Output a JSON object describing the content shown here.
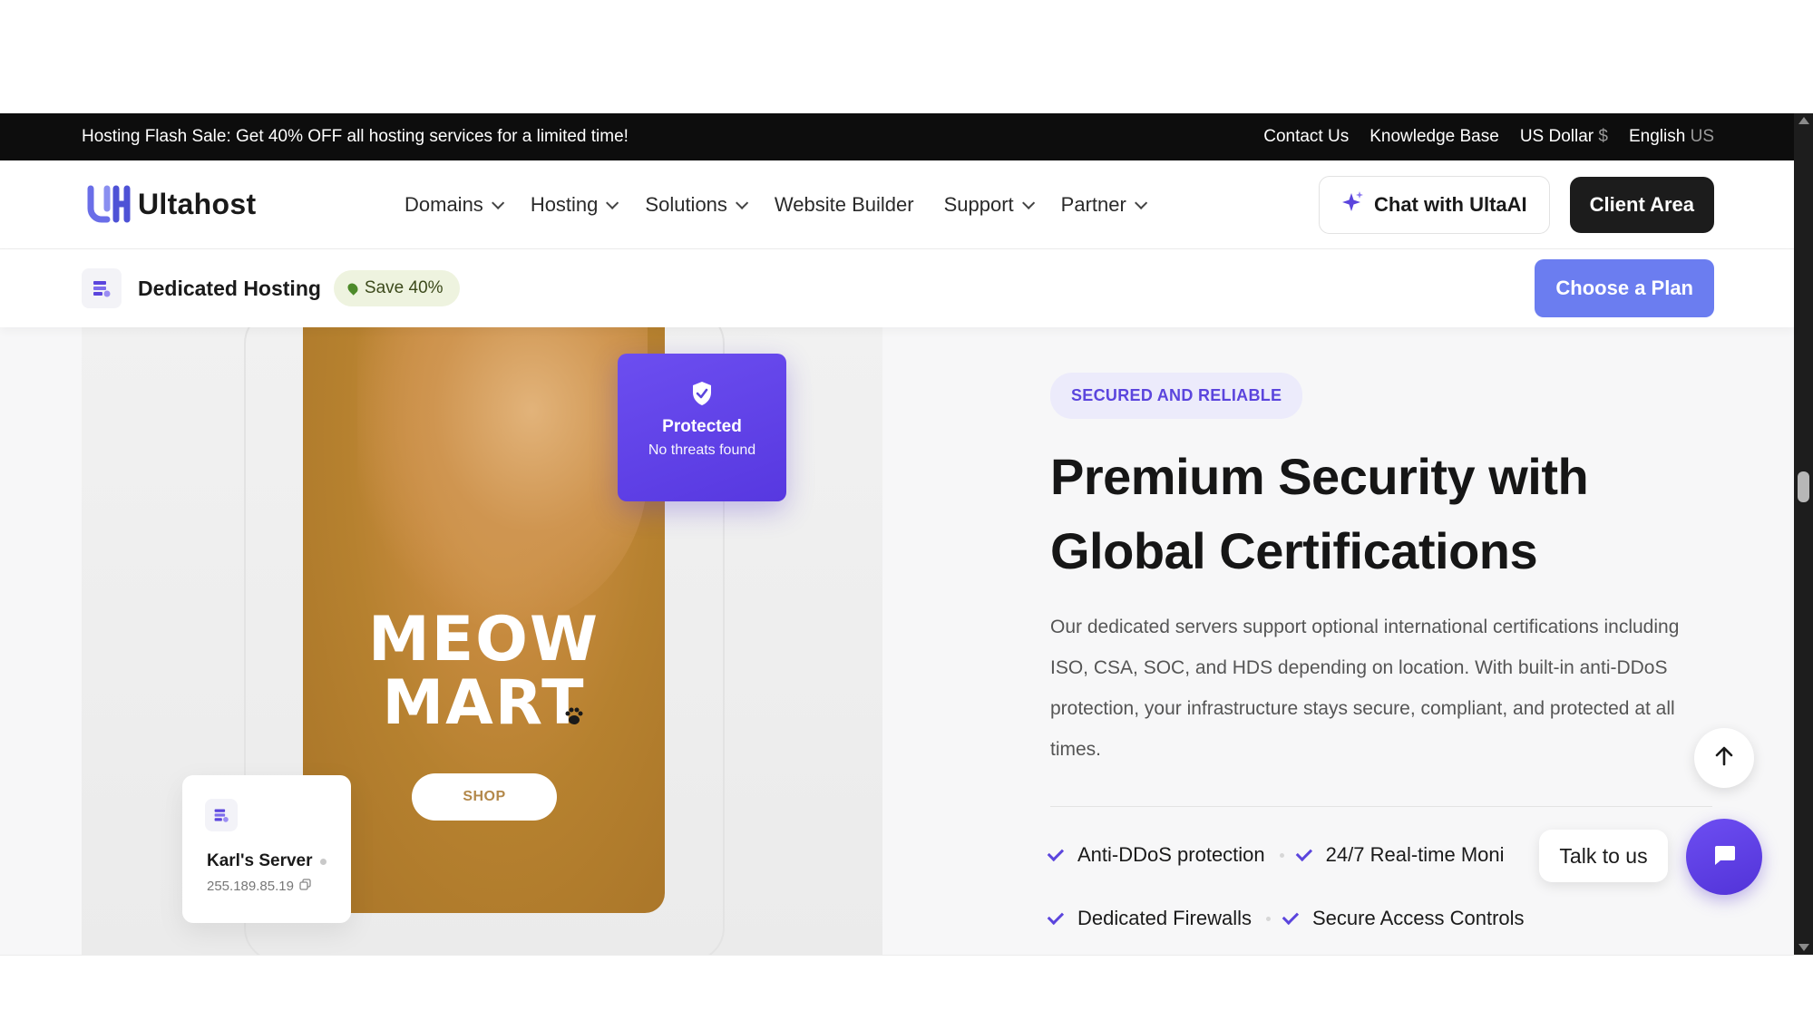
{
  "flash_bar": {
    "promo": "Hosting Flash Sale: Get 40% OFF all hosting services for a limited time!",
    "contact": "Contact Us",
    "knowledge": "Knowledge Base",
    "currency": "US Dollar",
    "currency_symbol": "$",
    "language": "English",
    "language_code": "US"
  },
  "nav": {
    "logo_text": "Ultahost",
    "items": [
      {
        "label": "Domains",
        "has_dropdown": true
      },
      {
        "label": "Hosting",
        "has_dropdown": true
      },
      {
        "label": "Solutions",
        "has_dropdown": true
      },
      {
        "label": "Website Builder",
        "has_dropdown": false
      },
      {
        "label": "Support",
        "has_dropdown": true
      },
      {
        "label": "Partner",
        "has_dropdown": true
      }
    ],
    "chat_button": "Chat with UltaAI",
    "client_button": "Client Area"
  },
  "subnav": {
    "title": "Dedicated Hosting",
    "badge": "Save 40%",
    "cta": "Choose a Plan"
  },
  "visual": {
    "store_name": "MEOW MART",
    "shop_button": "SHOP",
    "protected_title": "Protected",
    "protected_sub": "No threats found",
    "server_name": "Karl's Server",
    "server_ip": "255.189.85.19"
  },
  "section": {
    "eyebrow": "SECURED AND RELIABLE",
    "headline": "Premium Security with Global Certifications",
    "description": "Our dedicated servers support optional international certifications including ISO, CSA, SOC, and HDS depending on location. With built-in anti-DDoS protection, your infrastructure stays secure, compliant, and protected at all times.",
    "features": [
      "Anti-DDoS protection",
      "24/7 Real-time Moni",
      "Dedicated Firewalls",
      "Secure Access Controls"
    ]
  },
  "floating": {
    "talk_label": "Talk to us"
  },
  "colors": {
    "brand_purple": "#5b45dd",
    "plan_button": "#6b7df0",
    "flash_bar_bg": "#0d0d0d",
    "client_btn_bg": "#1c1c1c"
  },
  "icons": [
    "chevron-down-icon",
    "sparkle-icon",
    "server-icon",
    "shield-check-icon",
    "paw-icon",
    "copy-icon",
    "check-icon",
    "arrow-up-icon",
    "chat-bubble-icon",
    "location-pin-icon"
  ]
}
